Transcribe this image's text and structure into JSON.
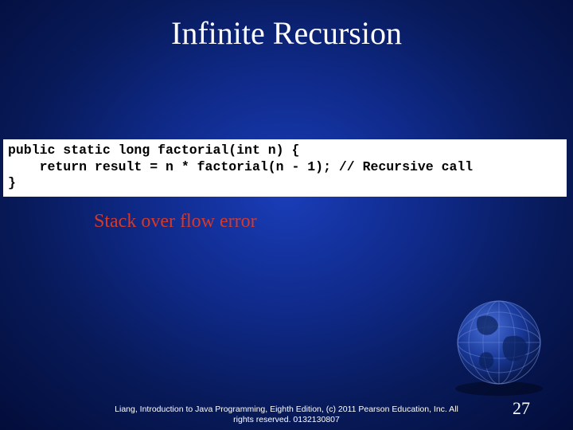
{
  "title": "Infinite Recursion",
  "code": {
    "line1": "public static long factorial(int n) {",
    "line2": "    return result = n * factorial(n - 1); // Recursive call",
    "line3": "}"
  },
  "error_text": "Stack over flow error",
  "footer": {
    "line1": "Liang, Introduction to Java Programming, Eighth Edition, (c) 2011 Pearson Education, Inc. All",
    "line2": "rights reserved. 0132130807"
  },
  "page_number": "27"
}
